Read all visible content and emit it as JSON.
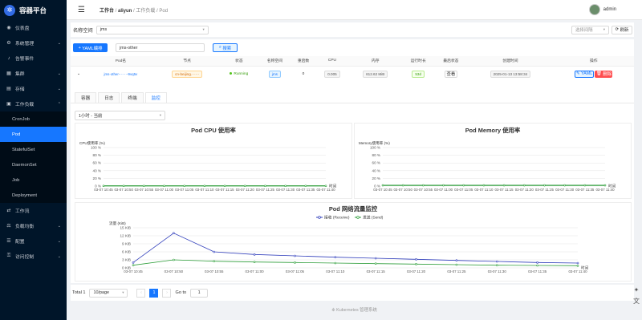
{
  "app": {
    "name": "容器平台"
  },
  "colors": {
    "primary": "#1677ff",
    "sidebar": "#001529",
    "success": "#52c41a",
    "danger": "#ff4d4f"
  },
  "sidebar": {
    "items": [
      {
        "label": "仪表盘",
        "icon": "dashboard-icon"
      },
      {
        "label": "系统管理",
        "icon": "setting-icon",
        "expandable": true
      },
      {
        "label": "告警事件",
        "icon": "bell-icon"
      },
      {
        "label": "集群",
        "icon": "cluster-icon",
        "expandable": true
      },
      {
        "label": "存储",
        "icon": "storage-icon",
        "expandable": true
      },
      {
        "label": "工作负载",
        "icon": "workload-icon",
        "expandable": true,
        "expanded": true
      }
    ],
    "sub_items": [
      {
        "label": "CronJob"
      },
      {
        "label": "Pod",
        "active": true
      },
      {
        "label": "StatefulSet"
      },
      {
        "label": "DaemonSet"
      },
      {
        "label": "Job"
      },
      {
        "label": "Deployment"
      }
    ],
    "items_after": [
      {
        "label": "工作流",
        "icon": "workflow-icon"
      },
      {
        "label": "负载均衡",
        "icon": "balance-icon",
        "expandable": true
      },
      {
        "label": "配置",
        "icon": "config-icon",
        "expandable": true
      },
      {
        "label": "访问控制",
        "icon": "access-icon",
        "expandable": true
      }
    ]
  },
  "header": {
    "breadcrumb": [
      "工作台",
      "aliyun",
      "工作负载",
      "Pod"
    ],
    "user": "admin"
  },
  "filter": {
    "namespace_label": "名称空间",
    "namespace_value": "jms",
    "interval_placeholder": "选择间隔",
    "refresh": "刷新",
    "yaml_button": "YAML编排",
    "search_value": "jms-other",
    "search_button": "搜索"
  },
  "table": {
    "columns": [
      "Pod名",
      "节点",
      "状态",
      "名称空间",
      "重启数",
      "CPU",
      "内存",
      "运行时长",
      "最后状态",
      "创建时间",
      "操作"
    ],
    "row": {
      "pod_name": "jms-other-······-9vq5v",
      "node": "cn-beijing.······",
      "status": "Running",
      "namespace": "jms",
      "restarts": "0",
      "cpu": "0.005",
      "memory": "612.62 MiB",
      "uptime": "53d",
      "last_state": "查看",
      "created": "2025-01-13 13:58:34",
      "yaml": "YAML",
      "delete": "删除"
    }
  },
  "tabs": [
    "容器",
    "日志",
    "终端",
    "监控"
  ],
  "time_range": "1小时 - 当前",
  "chart_data": [
    {
      "type": "area",
      "title": "Pod CPU 使用率",
      "ylabel": "CPU使用率 (%)",
      "xlabel": "时间",
      "y_ticks": [
        "100 %",
        "80 %",
        "60 %",
        "40 %",
        "20 %",
        "0 %"
      ],
      "ylim": [
        0,
        100
      ],
      "x": [
        "03-07 10:45",
        "03-07 10:50",
        "03-07 10:55",
        "03-07 11:00",
        "03-07 11:05",
        "03-07 11:10",
        "03-07 11:15",
        "03-07 11:20",
        "03-07 11:25",
        "03-07 11:30",
        "03-07 11:35",
        "03-07 11:40"
      ],
      "values": [
        0.5,
        0.5,
        0.5,
        0.5,
        0.5,
        0.5,
        0.5,
        0.5,
        0.5,
        0.5,
        0.5,
        0.5
      ]
    },
    {
      "type": "area",
      "title": "Pod Memory 使用率",
      "ylabel": "Memory使用率 (%)",
      "xlabel": "时间",
      "y_ticks": [
        "100 %",
        "80 %",
        "60 %",
        "40 %",
        "20 %",
        "0 %"
      ],
      "ylim": [
        0,
        100
      ],
      "x": [
        "03-07 10:45",
        "03-07 10:50",
        "03-07 10:55",
        "03-07 11:00",
        "03-07 11:05",
        "03-07 11:10",
        "03-07 11:15",
        "03-07 11:20",
        "03-07 11:25",
        "03-07 11:30",
        "03-07 11:35",
        "03-07 11:40"
      ],
      "values": [
        2,
        2,
        2,
        2,
        2,
        2,
        2,
        2,
        2,
        2,
        2,
        2
      ]
    },
    {
      "type": "line",
      "title": "Pod 网络流量监控",
      "ylabel": "流量 (KiB)",
      "xlabel": "时间",
      "y_ticks": [
        "15 KiB",
        "12 KiB",
        "9 KiB",
        "6 KiB",
        "3 KiB",
        "0 KiB"
      ],
      "ylim": [
        0,
        15
      ],
      "x": [
        "03-07 10:45",
        "03-07 10:50",
        "03-07 10:55",
        "03-07 11:00",
        "03-07 11:05",
        "03-07 11:10",
        "03-07 11:15",
        "03-07 11:20",
        "03-07 11:25",
        "03-07 11:30",
        "03-07 11:35",
        "03-07 11:40"
      ],
      "series": [
        {
          "name": "接收 (Receive)",
          "color": "#2f3dbb",
          "values": [
            2,
            13,
            6,
            5,
            4.5,
            4,
            3.6,
            3.2,
            2.8,
            2.4,
            2,
            1.8
          ]
        },
        {
          "name": "发送 (Send)",
          "color": "#2e9e3a",
          "values": [
            1,
            3,
            2.5,
            2.2,
            2,
            1.8,
            1.6,
            1.4,
            1.2,
            1,
            0.9,
            0.8
          ]
        }
      ]
    }
  ],
  "pagination": {
    "total": "Total 1",
    "page_size": "10/page",
    "current": "1",
    "goto_label": "Go to",
    "goto_value": "1"
  },
  "footer": "Kubernetes 管理系统"
}
